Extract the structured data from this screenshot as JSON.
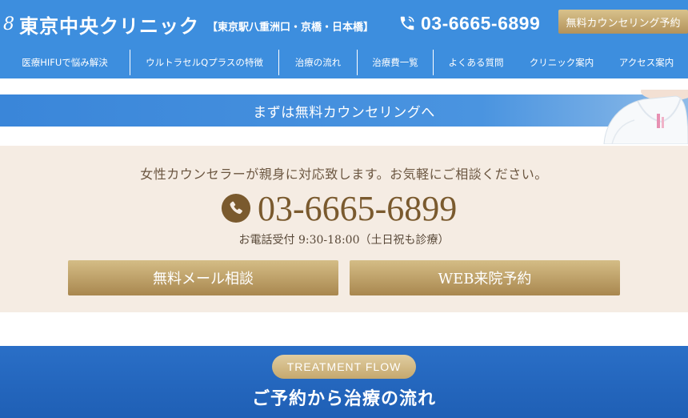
{
  "header": {
    "logo_mark": "8",
    "clinic_name": "東京中央クリニック",
    "clinic_locations": "【東京駅八重洲口・京橋・日本橋】",
    "phone_number": "03-6665-6899",
    "cta_label": "無料カウンセリング予約"
  },
  "nav": {
    "items": [
      {
        "label": "医療HIFUで悩み解決"
      },
      {
        "label": "ウルトラセルQプラスの特徴"
      },
      {
        "label": "治療の流れ"
      },
      {
        "label": "治療費一覧"
      },
      {
        "label": "よくある質問"
      },
      {
        "label": "クリニック案内"
      },
      {
        "label": "アクセス案内"
      }
    ]
  },
  "banner": {
    "text": "まずは無料カウンセリングへ"
  },
  "contact": {
    "lead": "女性カウンセラーが親身に対応致します。お気軽にご相談ください。",
    "phone_number": "03-6665-6899",
    "hours": "お電話受付 9:30-18:00（土日祝も診療）",
    "mail_button": "無料メール相談",
    "web_button": "WEB来院予約"
  },
  "flow": {
    "badge": "TREATMENT FLOW",
    "title": "ご予約から治療の流れ"
  },
  "colors": {
    "brand_blue": "#3d8ede",
    "gold": "#b3925a",
    "cream": "#f5ece3",
    "phone_brown": "#7a5a2e"
  },
  "icons": {
    "header_phone": "phone-icon",
    "contact_phone": "phone-circle-icon"
  }
}
